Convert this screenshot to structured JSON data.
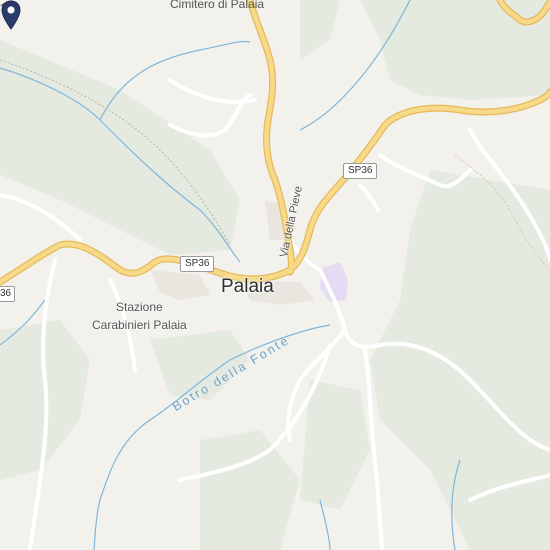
{
  "map": {
    "town_label": "Palaia",
    "cemetery_label": "Cimitero di Palaia",
    "street_label": "Via della Pieve",
    "river_label": "Botro della Fonte",
    "poi_lines": [
      "Stazione",
      "Carabinieri Palaia"
    ],
    "road_shields": [
      "SP36",
      "SP36",
      "36"
    ],
    "colors": {
      "land": "#f3f1ec",
      "woodland": "#e5eae0",
      "major_road": "#f7d98a",
      "road_casing": "#e6b95a",
      "minor_road": "#ffffff",
      "water": "#7fb6d9",
      "pin": "#2b3a6b",
      "poi_area": "#e3dcf3"
    },
    "icons": [
      "location-pin-icon",
      "carabinieri-station-icon"
    ]
  }
}
